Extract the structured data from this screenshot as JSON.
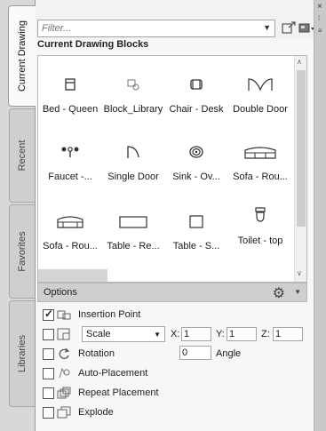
{
  "tabs": [
    {
      "label": "Current Drawing",
      "active": true
    },
    {
      "label": "Recent",
      "active": false
    },
    {
      "label": "Favorites",
      "active": false
    },
    {
      "label": "Libraries",
      "active": false
    }
  ],
  "toolbar": {
    "filter_placeholder": "Filter...",
    "load_icon": "import-block-icon",
    "view_icon": "thumbnail-view-icon"
  },
  "section_title": "Current Drawing Blocks",
  "blocks": [
    {
      "name": "Bed - Queen",
      "icon": "bed-icon"
    },
    {
      "name": "Block_Library",
      "icon": "block-library-icon"
    },
    {
      "name": "Chair - Desk",
      "icon": "chair-icon"
    },
    {
      "name": "Double Door",
      "icon": "double-door-icon"
    },
    {
      "name": "Faucet -...",
      "icon": "faucet-icon"
    },
    {
      "name": "Single Door",
      "icon": "single-door-icon"
    },
    {
      "name": "Sink - Ov...",
      "icon": "sink-icon"
    },
    {
      "name": "Sofa - Rou...",
      "icon": "sofa-icon"
    },
    {
      "name": "Sofa - Rou...",
      "icon": "sofa-icon"
    },
    {
      "name": "Table - Re...",
      "icon": "rect-table-icon"
    },
    {
      "name": "Table - S...",
      "icon": "square-table-icon"
    },
    {
      "name": "Toilet - top",
      "icon": "toilet-icon"
    }
  ],
  "options": {
    "header": "Options",
    "insertion_point": {
      "label": "Insertion Point",
      "checked": true
    },
    "scale": {
      "label": "Scale",
      "checked": false,
      "x_label": "X:",
      "x": "1",
      "y_label": "Y:",
      "y": "1",
      "z_label": "Z:",
      "z": "1"
    },
    "rotation": {
      "label": "Rotation",
      "checked": false,
      "value": "0",
      "unit_label": "Angle"
    },
    "auto_placement": {
      "label": "Auto-Placement",
      "checked": false
    },
    "repeat_placement": {
      "label": "Repeat Placement",
      "checked": false
    },
    "explode": {
      "label": "Explode",
      "checked": false
    }
  }
}
